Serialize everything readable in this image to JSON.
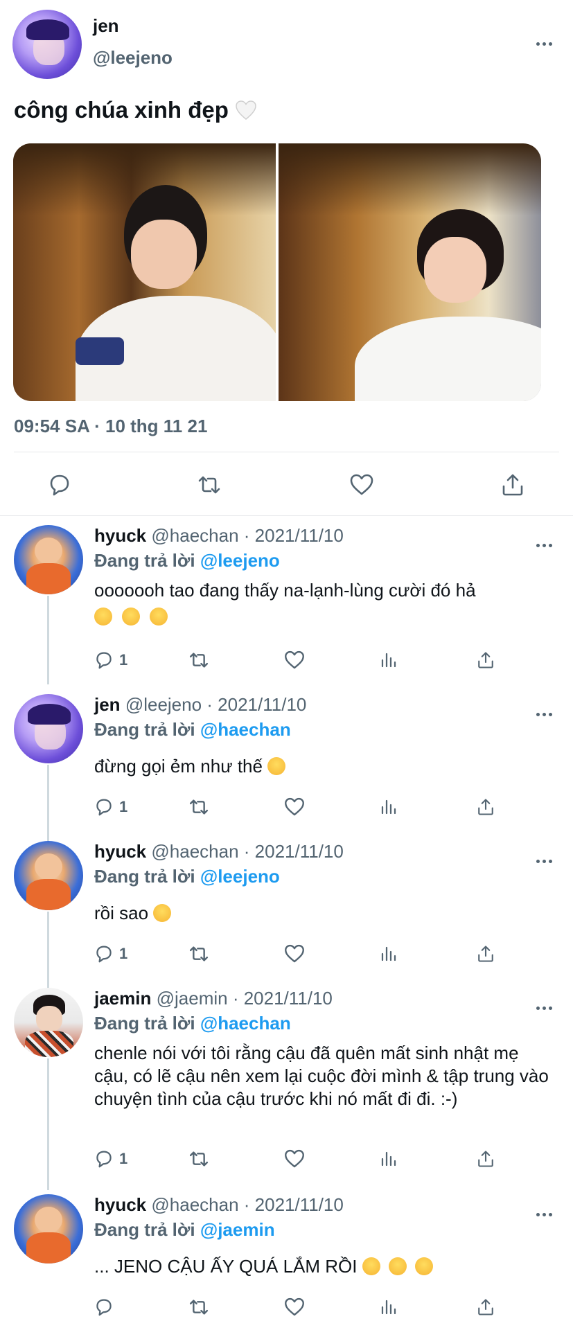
{
  "main_tweet": {
    "name": "jen",
    "handle": "@leejeno",
    "text": "công chúa xinh đẹp",
    "timestamp": "09:54 SA · 10 thg 11 21",
    "icons": [
      "more-icon",
      "reply-icon",
      "retweet-icon",
      "like-icon",
      "share-icon"
    ]
  },
  "replies": [
    {
      "name": "hyuck",
      "meta": "@haechan · 2021/11/10",
      "replying_prefix": "Đang trả lời",
      "replying_to": "@leejeno",
      "text": "ooooooh tao đang thấy na-lạnh-lùng cười đó hả",
      "reply_count": "1"
    },
    {
      "name": "jen",
      "meta": "@leejeno · 2021/11/10",
      "replying_prefix": "Đang trả lời",
      "replying_to": "@haechan",
      "text": "đừng gọi ẻm như thế",
      "reply_count": "1"
    },
    {
      "name": "hyuck",
      "meta": "@haechan · 2021/11/10",
      "replying_prefix": "Đang trả lời",
      "replying_to": "@leejeno",
      "text": "rồi sao",
      "reply_count": "1"
    },
    {
      "name": "jaemin",
      "meta": "@jaemin · 2021/11/10",
      "replying_prefix": "Đang trả lời",
      "replying_to": "@haechan",
      "text": "chenle nói với tôi rằng cậu đã quên mất sinh nhật mẹ cậu, có lẽ cậu nên xem lại cuộc đời mình & tập trung vào chuyện tình của cậu trước khi nó mất đi đi. :-)",
      "reply_count": "1"
    },
    {
      "name": "hyuck",
      "meta": "@haechan · 2021/11/10",
      "replying_prefix": "Đang trả lời",
      "replying_to": "@jaemin",
      "text": "... JENO CẬU ẤY QUÁ LẮM RỒI",
      "reply_count": ""
    }
  ],
  "colors": {
    "accent": "#1d9bf0",
    "secondary_text": "#536471",
    "divider": "#e6e8ea"
  }
}
